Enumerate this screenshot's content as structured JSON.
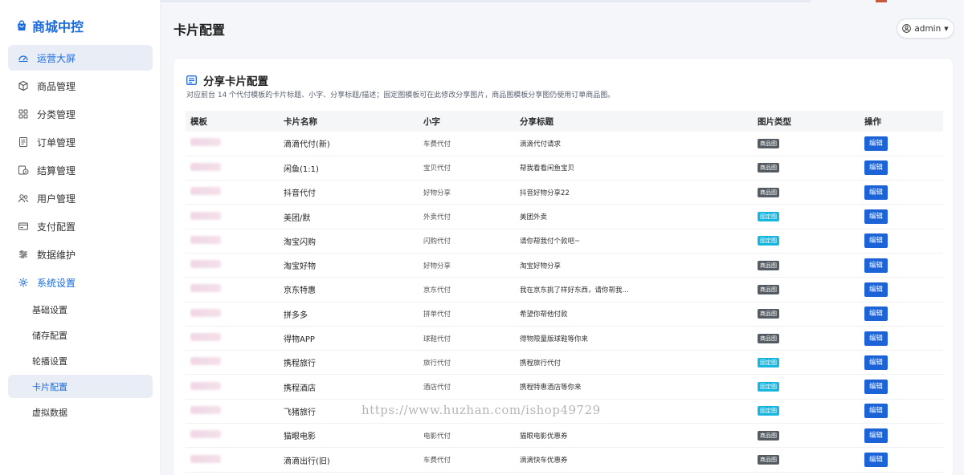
{
  "brand": {
    "name": "商城中控"
  },
  "sidebar": {
    "items": [
      {
        "label": "运营大屏",
        "icon": "dashboard-icon"
      },
      {
        "label": "商品管理",
        "icon": "box-icon"
      },
      {
        "label": "分类管理",
        "icon": "grid-icon"
      },
      {
        "label": "订单管理",
        "icon": "list-icon"
      },
      {
        "label": "结算管理",
        "icon": "settlement-icon"
      },
      {
        "label": "用户管理",
        "icon": "users-icon"
      },
      {
        "label": "支付配置",
        "icon": "card-icon"
      },
      {
        "label": "数据维护",
        "icon": "sliders-icon"
      },
      {
        "label": "系统设置",
        "icon": "gear-icon"
      }
    ],
    "subitems": [
      {
        "label": "基础设置"
      },
      {
        "label": "储存配置"
      },
      {
        "label": "轮播设置"
      },
      {
        "label": "卡片配置"
      },
      {
        "label": "虚拟数据"
      }
    ]
  },
  "header": {
    "title": "卡片配置",
    "user": "admin"
  },
  "card": {
    "title": "分享卡片配置",
    "description": "对应前台 14 个代付模板的卡片标题、小字、分享标题/描述；固定图模板可在此修改分享图片，商品图模板分享图仍使用订单商品图。"
  },
  "table": {
    "headers": [
      "模板",
      "卡片名称",
      "小字",
      "分享标题",
      "图片类型",
      "操作"
    ],
    "edit_label": "编辑",
    "rows": [
      {
        "name": "滴滴代付(新)",
        "small": "车费代付",
        "share": "滴滴代付请求",
        "type": "商品图"
      },
      {
        "name": "闲鱼(1:1)",
        "small": "宝贝代付",
        "share": "帮我看看闲鱼宝贝",
        "type": "商品图"
      },
      {
        "name": "抖音代付",
        "small": "好物分享",
        "share": "抖音好物分享22",
        "type": "商品图"
      },
      {
        "name": "美团/默",
        "small": "外卖代付",
        "share": "美团外卖",
        "type": "固定图"
      },
      {
        "name": "淘宝闪购",
        "small": "闪购代付",
        "share": "请你帮我付个款吧~",
        "type": "固定图"
      },
      {
        "name": "淘宝好物",
        "small": "好物分享",
        "share": "淘宝好物分享",
        "type": "商品图"
      },
      {
        "name": "京东特惠",
        "small": "京东代付",
        "share": "我在京东挑了样好东西，请你帮我...",
        "type": "商品图"
      },
      {
        "name": "拼多多",
        "small": "拼单代付",
        "share": "希望你帮他付款",
        "type": "商品图"
      },
      {
        "name": "得物APP",
        "small": "球鞋代付",
        "share": "得物限量版球鞋等你来",
        "type": "商品图"
      },
      {
        "name": "携程旅行",
        "small": "旅行代付",
        "share": "携程旅行代付",
        "type": "固定图"
      },
      {
        "name": "携程酒店",
        "small": "酒店代付",
        "share": "携程特惠酒店等你来",
        "type": "固定图"
      },
      {
        "name": "飞猪旅行",
        "small": "",
        "share": "",
        "type": "固定图"
      },
      {
        "name": "猫眼电影",
        "small": "电影代付",
        "share": "猫眼电影优惠券",
        "type": "商品图"
      },
      {
        "name": "滴滴出行(旧)",
        "small": "车费代付",
        "share": "滴滴快车优惠券",
        "type": "商品图"
      }
    ]
  },
  "watermark": "https://www.huzhan.com/ishop49729",
  "colors": {
    "accent": "#1a6be0",
    "edit_button": "#1d63d8",
    "tag_goods": "#545b62",
    "tag_fixed": "#16b6de"
  }
}
